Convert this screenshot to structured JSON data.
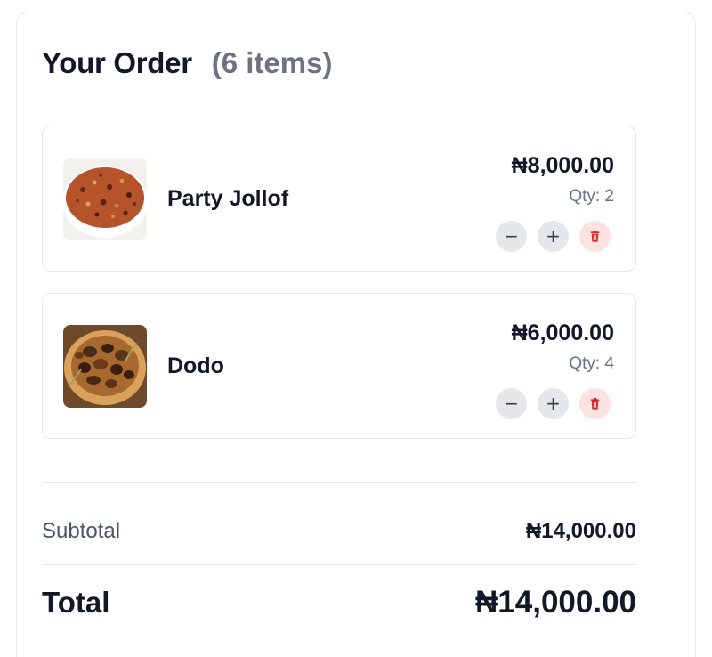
{
  "order": {
    "title": "Your Order",
    "item_count": "(6 items)"
  },
  "items": [
    {
      "name": "Party Jollof",
      "price": "₦8,000.00",
      "qty": "Qty: 2",
      "decrease": "−",
      "increase": "+"
    },
    {
      "name": "Dodo",
      "price": "₦6,000.00",
      "qty": "Qty: 4",
      "decrease": "−",
      "increase": "+"
    }
  ],
  "summary": {
    "subtotal_label": "Subtotal",
    "subtotal_value": "₦14,000.00",
    "total_label": "Total",
    "total_value": "₦14,000.00"
  },
  "colors": {
    "delete_icon": "#dc2626",
    "delete_bg": "#fee2e2",
    "muted_text": "#6b7280"
  },
  "icons": [
    "minus-icon",
    "plus-icon",
    "trash-icon"
  ]
}
